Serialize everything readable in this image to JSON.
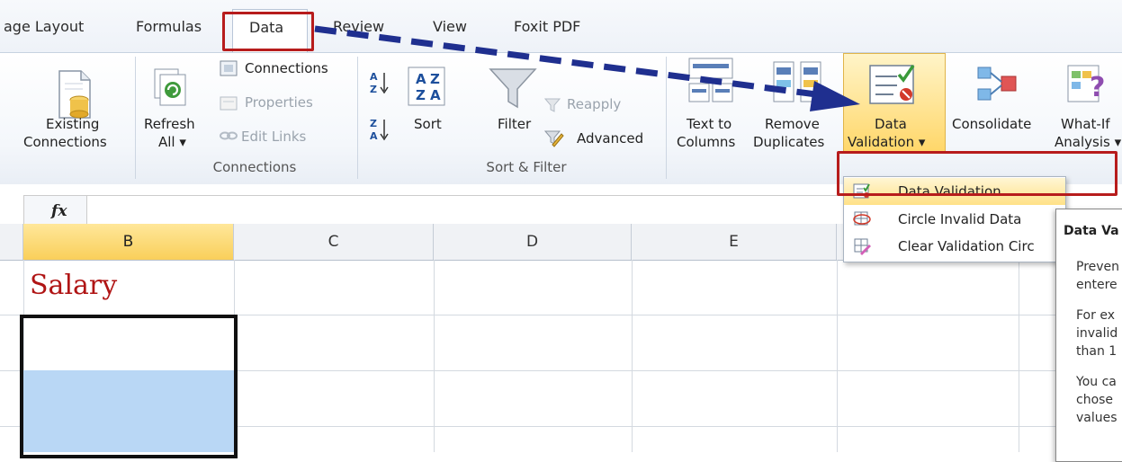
{
  "tabs": {
    "page_layout": "age Layout",
    "formulas": "Formulas",
    "data": "Data",
    "review": "Review",
    "view": "View",
    "foxit": "Foxit PDF"
  },
  "ribbon": {
    "existing_connections": [
      "Existing",
      "Connections"
    ],
    "refresh_all": [
      "Refresh",
      "All ▾"
    ],
    "connections": "Connections",
    "properties": "Properties",
    "edit_links": "Edit Links",
    "connections_group": "Connections",
    "sort": "Sort",
    "filter": "Filter",
    "reapply": "Reapply",
    "advanced": "Advanced",
    "sort_filter_group": "Sort & Filter",
    "text_to_columns": [
      "Text to",
      "Columns"
    ],
    "remove_duplicates": [
      "Remove",
      "Duplicates"
    ],
    "data_validation": [
      "Data",
      "Validation ▾"
    ],
    "consolidate": "Consolidate",
    "what_if": [
      "What-If",
      "Analysis ▾"
    ]
  },
  "formula_bar": {
    "fx": "fx"
  },
  "grid": {
    "columns": [
      "B",
      "C",
      "D",
      "E"
    ],
    "cell_b1": "Salary"
  },
  "dropdown": {
    "items": [
      {
        "label": "Data Validation..."
      },
      {
        "label": "Circle Invalid Data"
      },
      {
        "label": "Clear Validation Circ"
      }
    ]
  },
  "tooltip": {
    "title": "Data Va",
    "lines": [
      "Preven",
      "entere",
      "For ex",
      "invalid",
      "than 1",
      "You ca",
      "chose",
      "values"
    ]
  },
  "colors": {
    "accent_red": "#b71c1c",
    "salary_red": "#b01515",
    "selection_blue": "#b9d7f5",
    "arrow_blue": "#1f2f8f"
  }
}
